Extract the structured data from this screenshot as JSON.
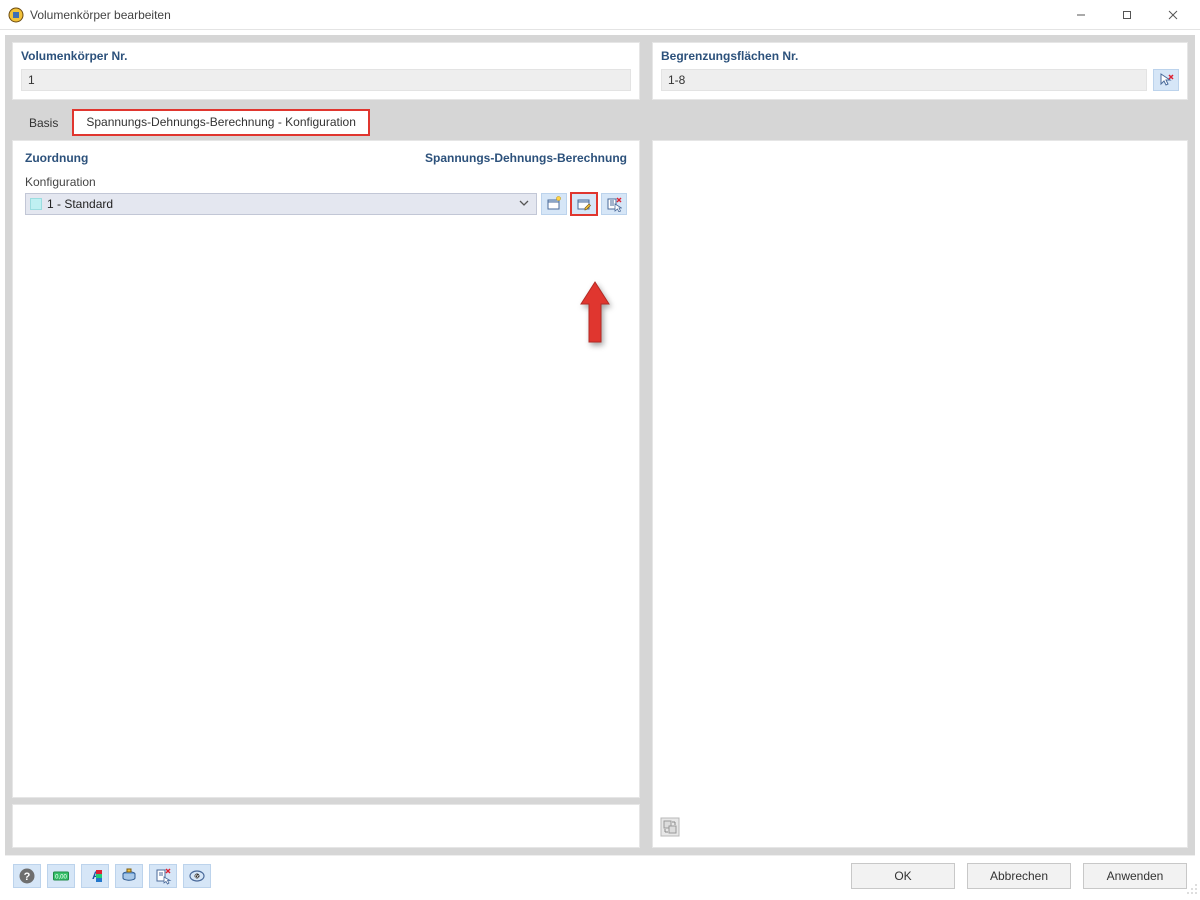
{
  "window": {
    "title": "Volumenkörper bearbeiten"
  },
  "header": {
    "left_label": "Volumenkörper Nr.",
    "left_value": "1",
    "right_label": "Begrenzungsflächen Nr.",
    "right_value": "1-8"
  },
  "tabs": {
    "basis": "Basis",
    "config": "Spannungs-Dehnungs-Berechnung - Konfiguration"
  },
  "assignment": {
    "heading_left": "Zuordnung",
    "heading_right": "Spannungs-Dehnungs-Berechnung",
    "config_label": "Konfiguration",
    "selected": "1 - Standard"
  },
  "footer": {
    "ok": "OK",
    "cancel": "Abbrechen",
    "apply": "Anwenden"
  },
  "icons": {
    "pick": "pick-cursor",
    "new": "new-config",
    "edit": "edit-config",
    "clear": "clear-config",
    "help": "help",
    "units": "units",
    "font": "font-color",
    "layer": "layer",
    "detach": "detach",
    "func": "function"
  }
}
